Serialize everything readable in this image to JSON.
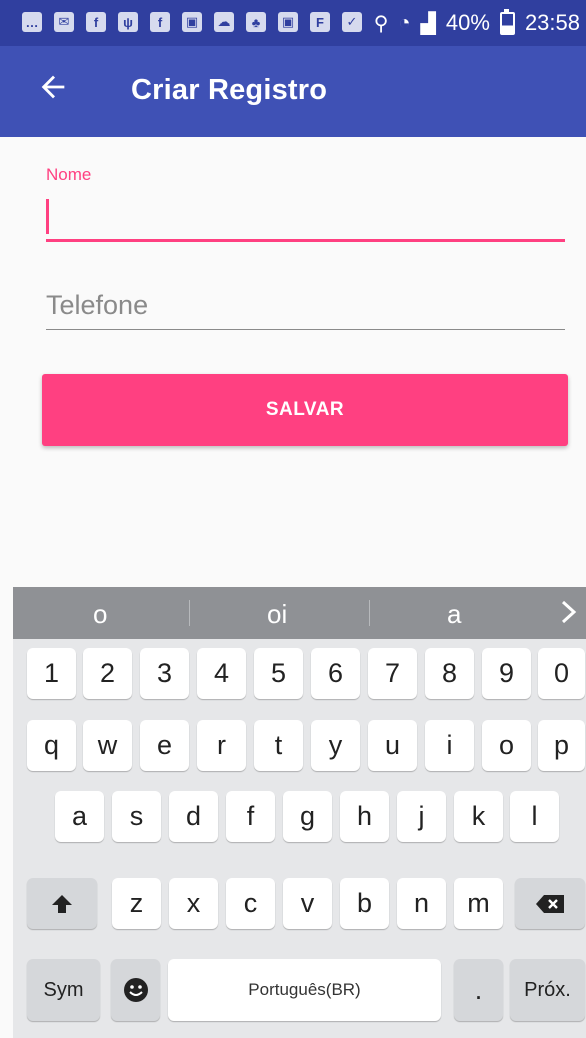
{
  "status_bar": {
    "notification_icons": [
      "chat-icon",
      "mail-icon",
      "facebook-icon",
      "usb-icon",
      "facebook-icon",
      "gallery-icon",
      "cloud-icon",
      "tree-icon",
      "gallery-icon",
      "flipboard-icon",
      "inbox-icon"
    ],
    "battery": "40%",
    "time": "23:58"
  },
  "app_bar": {
    "title": "Criar Registro",
    "background": "#3f51b5"
  },
  "form": {
    "name_label": "Nome",
    "name_value": "",
    "phone_placeholder": "Telefone",
    "phone_value": "",
    "save_label": "SALVAR",
    "accent": "#ff4081"
  },
  "keyboard": {
    "suggestions": [
      "o",
      "oi",
      "a"
    ],
    "row1": [
      "1",
      "2",
      "3",
      "4",
      "5",
      "6",
      "7",
      "8",
      "9",
      "0"
    ],
    "row2": [
      "q",
      "w",
      "e",
      "r",
      "t",
      "y",
      "u",
      "i",
      "o",
      "p"
    ],
    "row3": [
      "a",
      "s",
      "d",
      "f",
      "g",
      "h",
      "j",
      "k",
      "l"
    ],
    "row4": [
      "z",
      "x",
      "c",
      "v",
      "b",
      "n",
      "m"
    ],
    "sym_label": "Sym",
    "space_label": "Português(BR)",
    "period_label": ".",
    "next_label": "Próx."
  }
}
